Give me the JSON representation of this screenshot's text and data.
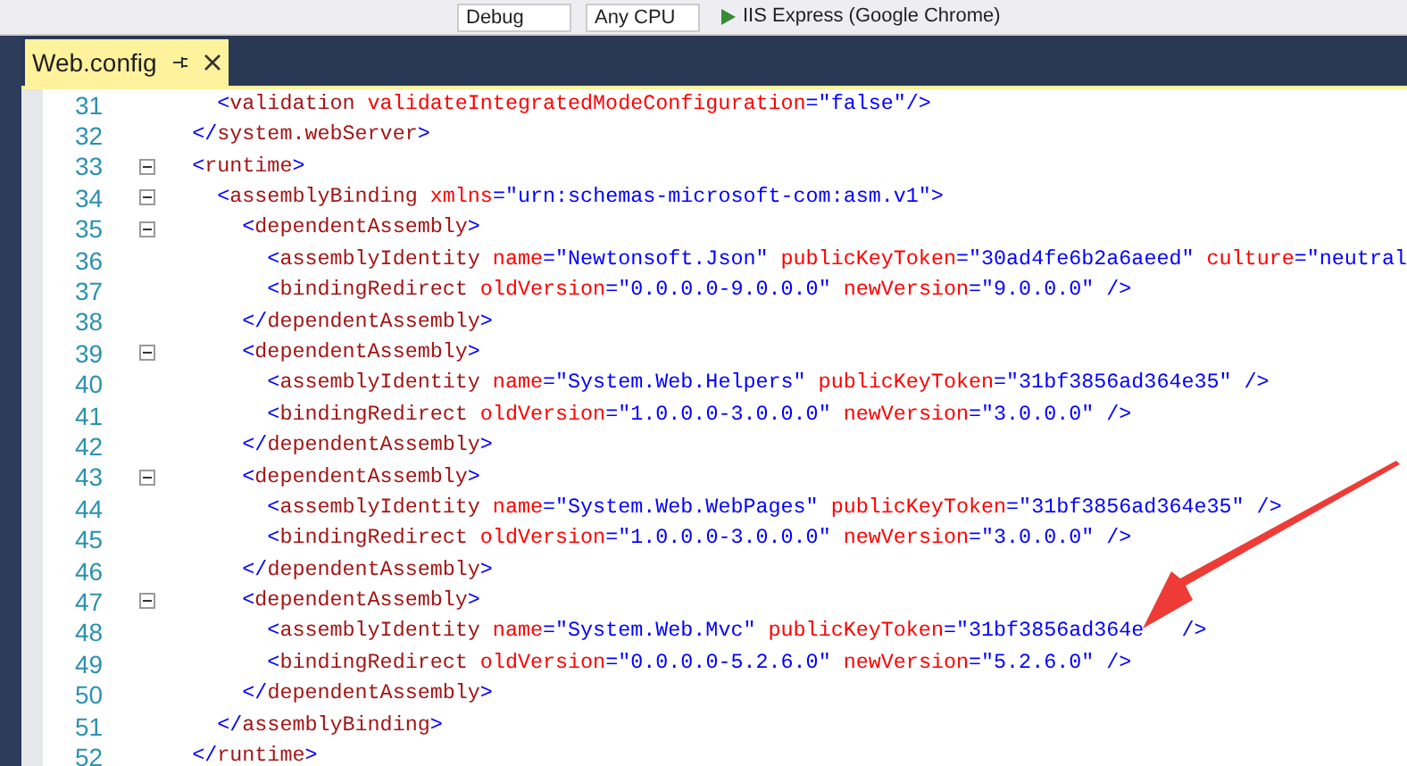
{
  "toolbar": {
    "items": [
      {
        "kind": "dropdown",
        "label": "Debug"
      },
      {
        "kind": "dropdown",
        "label": "Any CPU"
      },
      {
        "kind": "run",
        "label": "IIS Express (Google Chrome)"
      }
    ]
  },
  "tabs": [
    {
      "label": "Web.config",
      "selected": true,
      "pinned": true
    }
  ],
  "editor": {
    "lines": [
      {
        "number": "31",
        "collapsible": false,
        "tokens": [
          {
            "kind": "bracket",
            "text": "  <"
          },
          {
            "kind": "tag",
            "text": "validation"
          },
          {
            "kind": "attr",
            "text": " validateIntegratedModeConfiguration"
          },
          {
            "kind": "bracket",
            "text": "=\""
          },
          {
            "kind": "value",
            "text": "false"
          },
          {
            "kind": "bracket",
            "text": "\"/>"
          }
        ]
      },
      {
        "number": "32",
        "collapsible": false,
        "tokens": [
          {
            "kind": "bracket",
            "text": "</"
          },
          {
            "kind": "tag",
            "text": "system.webServer"
          },
          {
            "kind": "bracket",
            "text": ">"
          }
        ]
      },
      {
        "number": "33",
        "collapsible": true,
        "expanded": true,
        "tokens": [
          {
            "kind": "bracket",
            "text": "<"
          },
          {
            "kind": "tag",
            "text": "runtime"
          },
          {
            "kind": "bracket",
            "text": ">"
          }
        ]
      },
      {
        "number": "34",
        "collapsible": true,
        "expanded": true,
        "tokens": [
          {
            "kind": "bracket",
            "text": "  <"
          },
          {
            "kind": "tag",
            "text": "assemblyBinding"
          },
          {
            "kind": "attr",
            "text": " xmlns"
          },
          {
            "kind": "bracket",
            "text": "=\""
          },
          {
            "kind": "value",
            "text": "urn:schemas-microsoft-com:asm.v1"
          },
          {
            "kind": "bracket",
            "text": "\">"
          }
        ]
      },
      {
        "number": "35",
        "collapsible": true,
        "expanded": true,
        "tokens": [
          {
            "kind": "bracket",
            "text": "    <"
          },
          {
            "kind": "tag",
            "text": "dependentAssembly"
          },
          {
            "kind": "bracket",
            "text": ">"
          }
        ]
      },
      {
        "number": "36",
        "collapsible": false,
        "tokens": [
          {
            "kind": "bracket",
            "text": "      <"
          },
          {
            "kind": "tag",
            "text": "assemblyIdentity"
          },
          {
            "kind": "attr",
            "text": " name"
          },
          {
            "kind": "bracket",
            "text": "=\""
          },
          {
            "kind": "value",
            "text": "Newtonsoft.Json"
          },
          {
            "kind": "bracket",
            "text": "\""
          },
          {
            "kind": "attr",
            "text": " publicKeyToken"
          },
          {
            "kind": "bracket",
            "text": "=\""
          },
          {
            "kind": "value",
            "text": "30ad4fe6b2a6aeed"
          },
          {
            "kind": "bracket",
            "text": "\""
          },
          {
            "kind": "attr",
            "text": " culture"
          },
          {
            "kind": "bracket",
            "text": "=\""
          },
          {
            "kind": "value",
            "text": "neutral"
          }
        ]
      },
      {
        "number": "37",
        "collapsible": false,
        "tokens": [
          {
            "kind": "bracket",
            "text": "      <"
          },
          {
            "kind": "tag",
            "text": "bindingRedirect"
          },
          {
            "kind": "attr",
            "text": " oldVersion"
          },
          {
            "kind": "bracket",
            "text": "=\""
          },
          {
            "kind": "value",
            "text": "0.0.0.0-9.0.0.0"
          },
          {
            "kind": "bracket",
            "text": "\""
          },
          {
            "kind": "attr",
            "text": " newVersion"
          },
          {
            "kind": "bracket",
            "text": "=\""
          },
          {
            "kind": "value",
            "text": "9.0.0.0"
          },
          {
            "kind": "bracket",
            "text": "\" />"
          }
        ]
      },
      {
        "number": "38",
        "collapsible": false,
        "tokens": [
          {
            "kind": "bracket",
            "text": "    </"
          },
          {
            "kind": "tag",
            "text": "dependentAssembly"
          },
          {
            "kind": "bracket",
            "text": ">"
          }
        ]
      },
      {
        "number": "39",
        "collapsible": true,
        "expanded": true,
        "tokens": [
          {
            "kind": "bracket",
            "text": "    <"
          },
          {
            "kind": "tag",
            "text": "dependentAssembly"
          },
          {
            "kind": "bracket",
            "text": ">"
          }
        ]
      },
      {
        "number": "40",
        "collapsible": false,
        "tokens": [
          {
            "kind": "bracket",
            "text": "      <"
          },
          {
            "kind": "tag",
            "text": "assemblyIdentity"
          },
          {
            "kind": "attr",
            "text": " name"
          },
          {
            "kind": "bracket",
            "text": "=\""
          },
          {
            "kind": "value",
            "text": "System.Web.Helpers"
          },
          {
            "kind": "bracket",
            "text": "\""
          },
          {
            "kind": "attr",
            "text": " publicKeyToken"
          },
          {
            "kind": "bracket",
            "text": "=\""
          },
          {
            "kind": "value",
            "text": "31bf3856ad364e35"
          },
          {
            "kind": "bracket",
            "text": "\" />"
          }
        ]
      },
      {
        "number": "41",
        "collapsible": false,
        "tokens": [
          {
            "kind": "bracket",
            "text": "      <"
          },
          {
            "kind": "tag",
            "text": "bindingRedirect"
          },
          {
            "kind": "attr",
            "text": " oldVersion"
          },
          {
            "kind": "bracket",
            "text": "=\""
          },
          {
            "kind": "value",
            "text": "1.0.0.0-3.0.0.0"
          },
          {
            "kind": "bracket",
            "text": "\""
          },
          {
            "kind": "attr",
            "text": " newVersion"
          },
          {
            "kind": "bracket",
            "text": "=\""
          },
          {
            "kind": "value",
            "text": "3.0.0.0"
          },
          {
            "kind": "bracket",
            "text": "\" />"
          }
        ]
      },
      {
        "number": "42",
        "collapsible": false,
        "tokens": [
          {
            "kind": "bracket",
            "text": "    </"
          },
          {
            "kind": "tag",
            "text": "dependentAssembly"
          },
          {
            "kind": "bracket",
            "text": ">"
          }
        ]
      },
      {
        "number": "43",
        "collapsible": true,
        "expanded": true,
        "tokens": [
          {
            "kind": "bracket",
            "text": "    <"
          },
          {
            "kind": "tag",
            "text": "dependentAssembly"
          },
          {
            "kind": "bracket",
            "text": ">"
          }
        ]
      },
      {
        "number": "44",
        "collapsible": false,
        "tokens": [
          {
            "kind": "bracket",
            "text": "      <"
          },
          {
            "kind": "tag",
            "text": "assemblyIdentity"
          },
          {
            "kind": "attr",
            "text": " name"
          },
          {
            "kind": "bracket",
            "text": "=\""
          },
          {
            "kind": "value",
            "text": "System.Web.WebPages"
          },
          {
            "kind": "bracket",
            "text": "\""
          },
          {
            "kind": "attr",
            "text": " publicKeyToken"
          },
          {
            "kind": "bracket",
            "text": "=\""
          },
          {
            "kind": "value",
            "text": "31bf3856ad364e35"
          },
          {
            "kind": "bracket",
            "text": "\" />"
          }
        ]
      },
      {
        "number": "45",
        "collapsible": false,
        "tokens": [
          {
            "kind": "bracket",
            "text": "      <"
          },
          {
            "kind": "tag",
            "text": "bindingRedirect"
          },
          {
            "kind": "attr",
            "text": " oldVersion"
          },
          {
            "kind": "bracket",
            "text": "=\""
          },
          {
            "kind": "value",
            "text": "1.0.0.0-3.0.0.0"
          },
          {
            "kind": "bracket",
            "text": "\""
          },
          {
            "kind": "attr",
            "text": " newVersion"
          },
          {
            "kind": "bracket",
            "text": "=\""
          },
          {
            "kind": "value",
            "text": "3.0.0.0"
          },
          {
            "kind": "bracket",
            "text": "\" />"
          }
        ]
      },
      {
        "number": "46",
        "collapsible": false,
        "tokens": [
          {
            "kind": "bracket",
            "text": "    </"
          },
          {
            "kind": "tag",
            "text": "dependentAssembly"
          },
          {
            "kind": "bracket",
            "text": ">"
          }
        ]
      },
      {
        "number": "47",
        "collapsible": true,
        "expanded": true,
        "tokens": [
          {
            "kind": "bracket",
            "text": "    <"
          },
          {
            "kind": "tag",
            "text": "dependentAssembly"
          },
          {
            "kind": "bracket",
            "text": ">"
          }
        ]
      },
      {
        "number": "48",
        "collapsible": false,
        "tokens": [
          {
            "kind": "bracket",
            "text": "      <"
          },
          {
            "kind": "tag",
            "text": "assemblyIdentity"
          },
          {
            "kind": "attr",
            "text": " name"
          },
          {
            "kind": "bracket",
            "text": "=\""
          },
          {
            "kind": "value",
            "text": "System.Web.Mvc"
          },
          {
            "kind": "bracket",
            "text": "\""
          },
          {
            "kind": "attr",
            "text": " publicKeyToken"
          },
          {
            "kind": "bracket",
            "text": "=\""
          },
          {
            "kind": "value",
            "text": "31bf3856ad364e"
          },
          {
            "kind": "bracket",
            "text": "   />"
          }
        ]
      },
      {
        "number": "49",
        "collapsible": false,
        "tokens": [
          {
            "kind": "bracket",
            "text": "      <"
          },
          {
            "kind": "tag",
            "text": "bindingRedirect"
          },
          {
            "kind": "attr",
            "text": " oldVersion"
          },
          {
            "kind": "bracket",
            "text": "=\""
          },
          {
            "kind": "value",
            "text": "0.0.0.0-5.2.6.0"
          },
          {
            "kind": "bracket",
            "text": "\""
          },
          {
            "kind": "attr",
            "text": " newVersion"
          },
          {
            "kind": "bracket",
            "text": "=\""
          },
          {
            "kind": "value",
            "text": "5.2.6.0"
          },
          {
            "kind": "bracket",
            "text": "\" />"
          }
        ]
      },
      {
        "number": "50",
        "collapsible": false,
        "tokens": [
          {
            "kind": "bracket",
            "text": "    </"
          },
          {
            "kind": "tag",
            "text": "dependentAssembly"
          },
          {
            "kind": "bracket",
            "text": ">"
          }
        ]
      },
      {
        "number": "51",
        "collapsible": false,
        "tokens": [
          {
            "kind": "bracket",
            "text": "  </"
          },
          {
            "kind": "tag",
            "text": "assemblyBinding"
          },
          {
            "kind": "bracket",
            "text": ">"
          }
        ]
      },
      {
        "number": "52",
        "collapsible": false,
        "tokens": [
          {
            "kind": "bracket",
            "text": "</"
          },
          {
            "kind": "tag",
            "text": "runtime"
          },
          {
            "kind": "bracket",
            "text": ">"
          }
        ]
      }
    ]
  }
}
